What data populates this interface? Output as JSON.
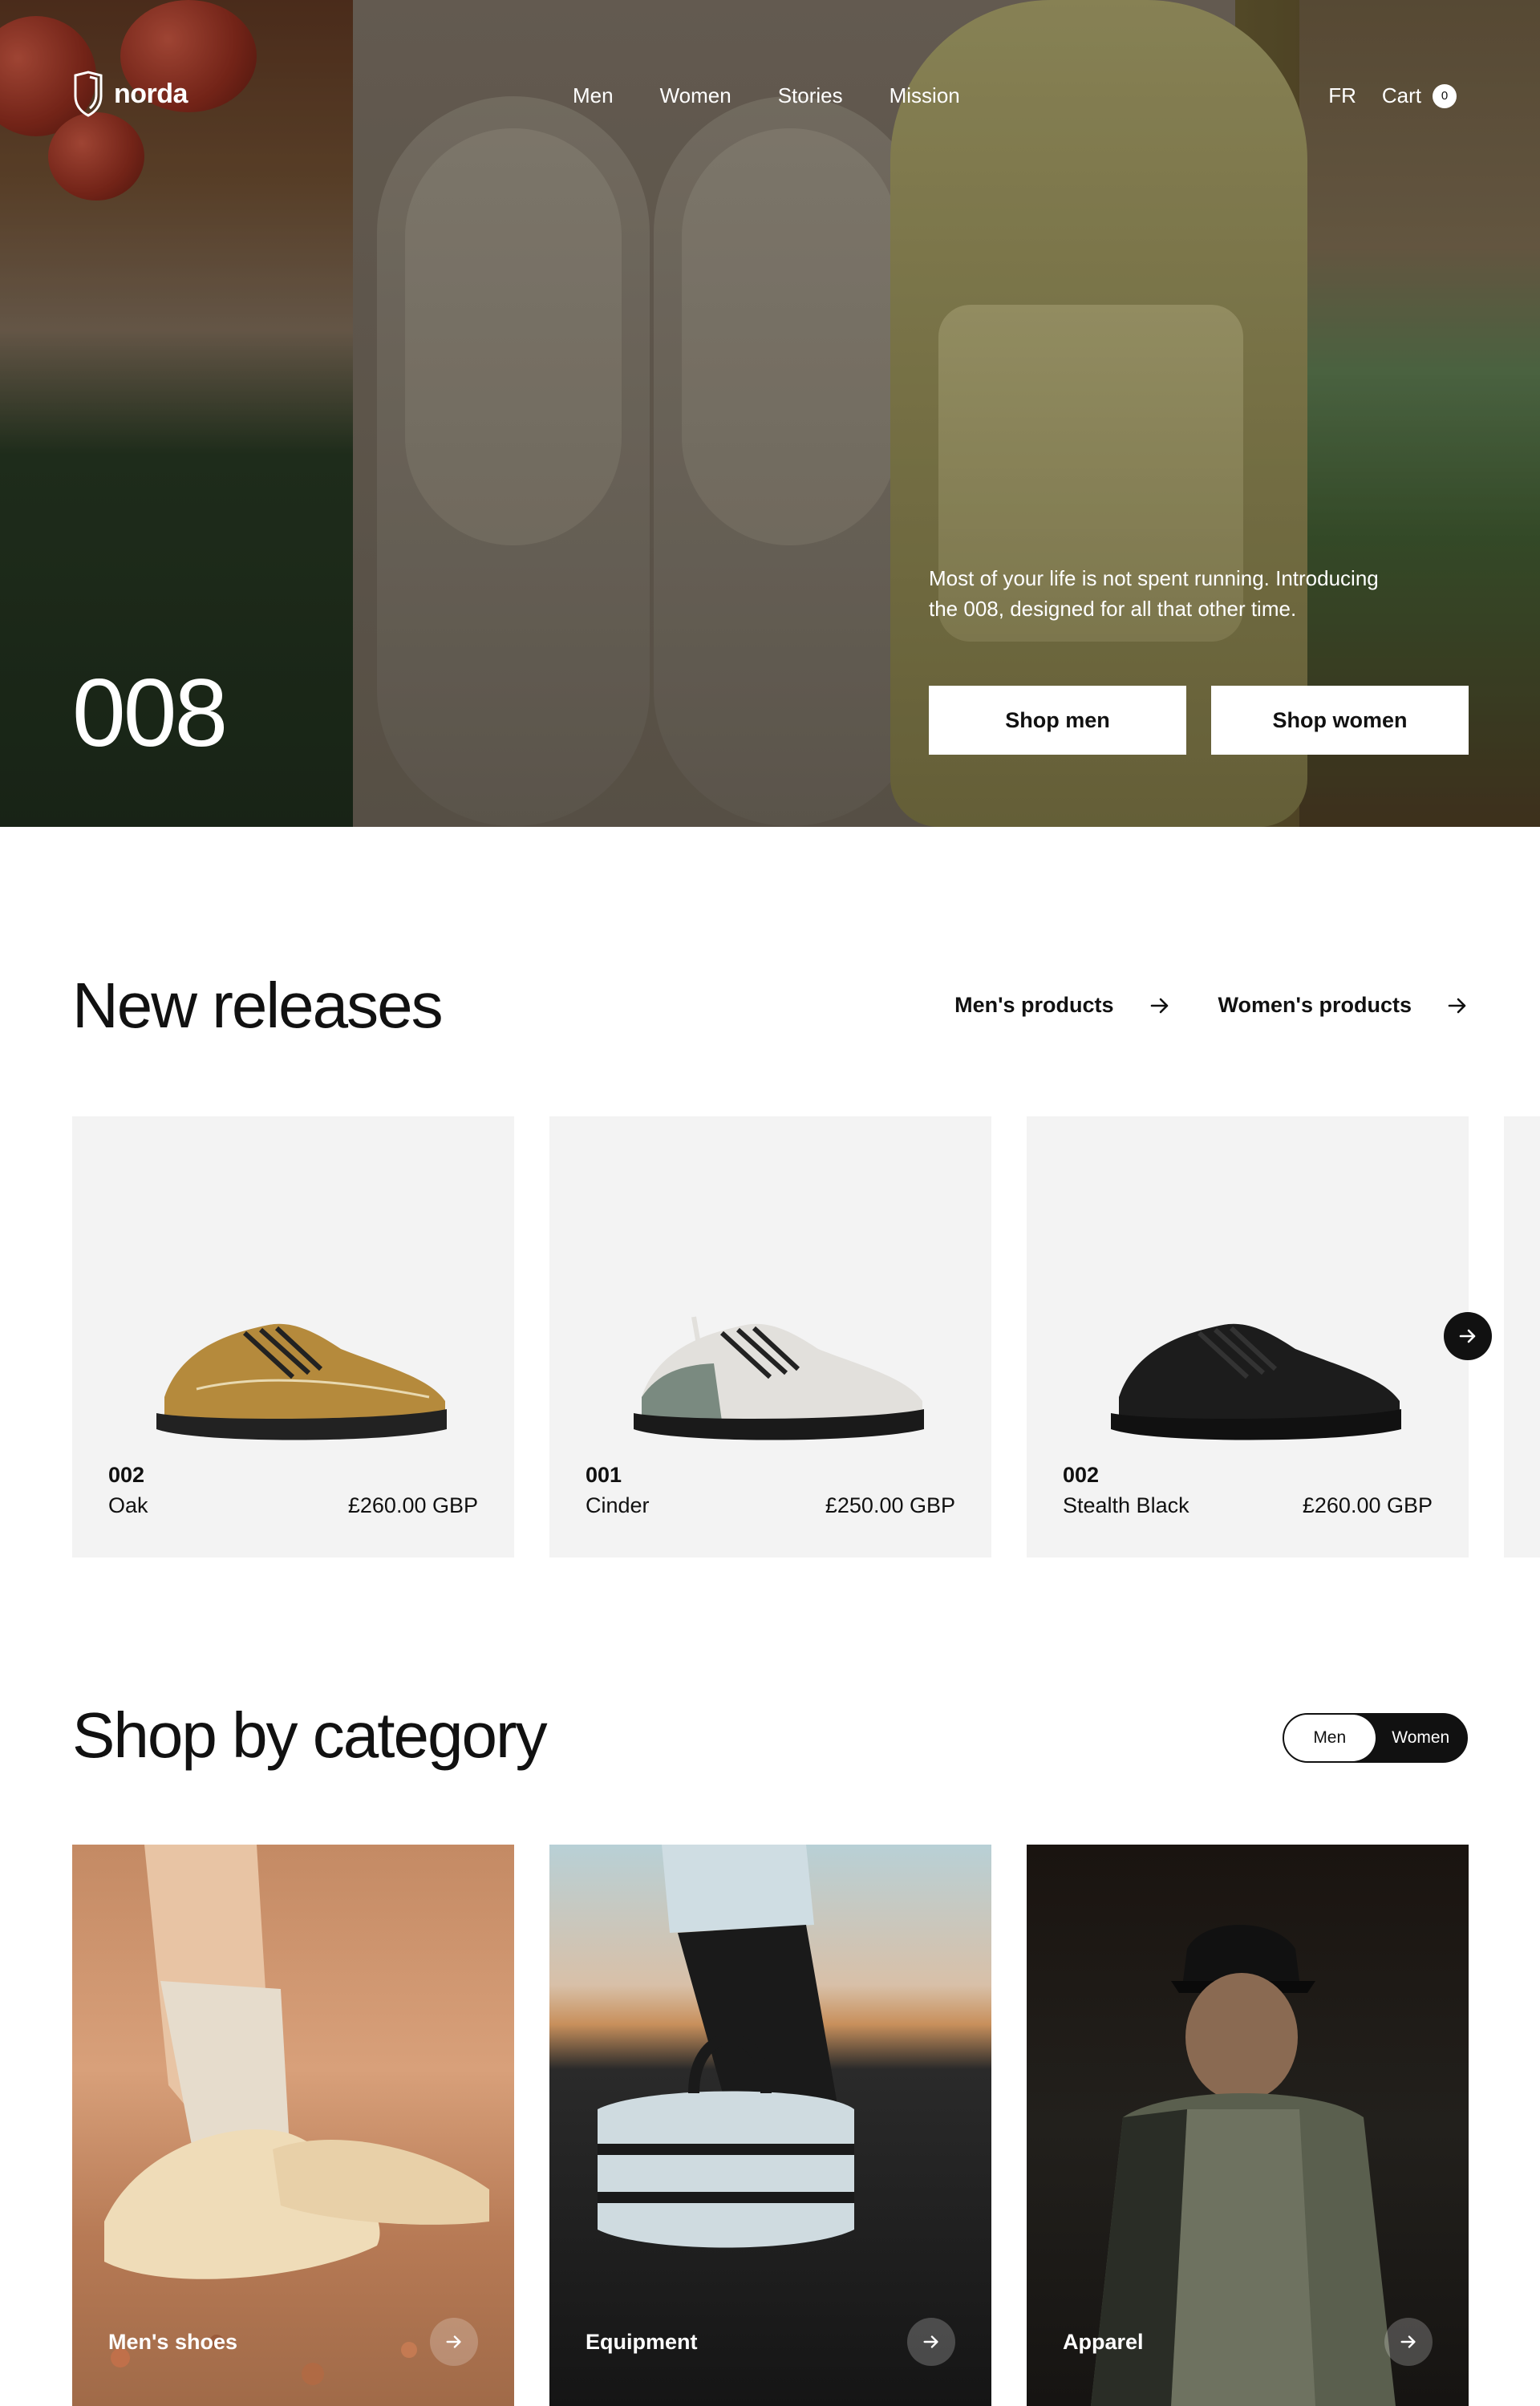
{
  "brand": {
    "name": "norda"
  },
  "nav": {
    "items": [
      "Men",
      "Women",
      "Stories",
      "Mission"
    ]
  },
  "header": {
    "language": "FR",
    "cart_label": "Cart",
    "cart_count": "0"
  },
  "hero": {
    "title": "008",
    "copy": "Most of your life is not spent running. Introducing the 008, designed for all that other time.",
    "button_men": "Shop men",
    "button_women": "Shop women"
  },
  "new_releases": {
    "title": "New releases",
    "link_men": "Men's products",
    "link_women": "Women's products",
    "products": [
      {
        "model": "002",
        "name": "Oak",
        "price": "£260.00 GBP",
        "color": "#b58a3c"
      },
      {
        "model": "001",
        "name": "Cinder",
        "price": "£250.00 GBP",
        "color": "#e2e0dc"
      },
      {
        "model": "002",
        "name": "Stealth Black",
        "price": "£260.00 GBP",
        "color": "#1c1c1c"
      }
    ]
  },
  "category": {
    "title": "Shop by category",
    "toggle": {
      "men": "Men",
      "women": "Women",
      "active": "Men"
    },
    "cards": [
      {
        "label": "Men's shoes"
      },
      {
        "label": "Equipment"
      },
      {
        "label": "Apparel"
      }
    ]
  },
  "colors": {
    "accent": "#111111",
    "card_bg": "#f3f3f3",
    "hero_text": "#ffffff"
  }
}
